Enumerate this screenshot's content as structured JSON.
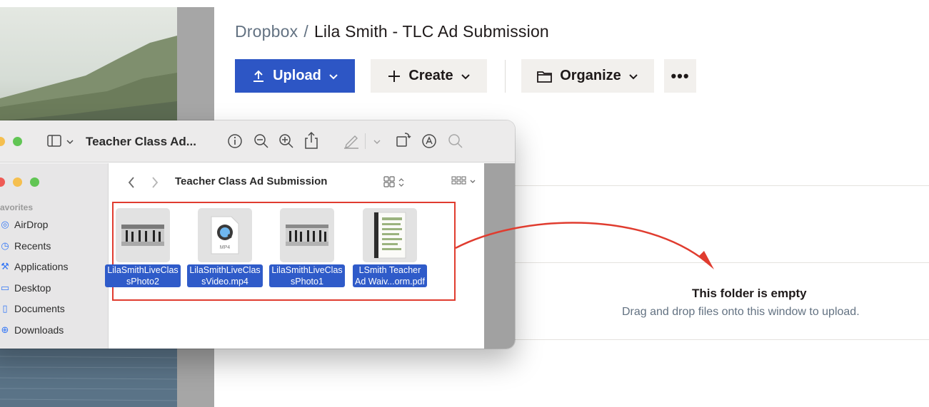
{
  "dropbox": {
    "breadcrumb_root": "Dropbox",
    "breadcrumb_separator": "/",
    "breadcrumb_current": "Lila Smith - TLC Ad Submission",
    "toolbar": {
      "upload_label": "Upload",
      "create_label": "Create",
      "organize_label": "Organize",
      "more_label": "•••"
    },
    "empty_state": {
      "title": "This folder is empty",
      "subtitle": "Drag and drop files onto this window to upload."
    },
    "accent_color": "#2d56c5"
  },
  "preview_window": {
    "title": "Teacher Class Ad...",
    "icons": [
      "sidebar-icon",
      "info-icon",
      "zoom-out-icon",
      "zoom-in-icon",
      "share-icon",
      "markup-icon",
      "rotate-icon",
      "annotate-icon",
      "search-icon"
    ]
  },
  "finder": {
    "folder_title": "Teacher Class Ad Submission",
    "favorites_header": "avorites",
    "favorites": [
      {
        "label": "AirDrop",
        "icon": "airdrop-icon"
      },
      {
        "label": "Recents",
        "icon": "clock-icon"
      },
      {
        "label": "Applications",
        "icon": "applications-icon"
      },
      {
        "label": "Desktop",
        "icon": "desktop-icon"
      },
      {
        "label": "Documents",
        "icon": "document-icon"
      },
      {
        "label": "Downloads",
        "icon": "download-icon"
      }
    ],
    "files": [
      {
        "line1": "LilaSmithLiveClas",
        "line2": "sPhoto2",
        "kind": "photo"
      },
      {
        "line1": "LilaSmithLiveClas",
        "line2": "sVideo.mp4",
        "kind": "mp4",
        "badge": "MP4"
      },
      {
        "line1": "LilaSmithLiveClas",
        "line2": "sPhoto1",
        "kind": "photo"
      },
      {
        "line1": "LSmith Teacher",
        "line2": "Ad Waiv...orm.pdf",
        "kind": "pdf"
      }
    ],
    "selection_color": "#2f5bc9",
    "highlight_color": "#e03c2f"
  }
}
